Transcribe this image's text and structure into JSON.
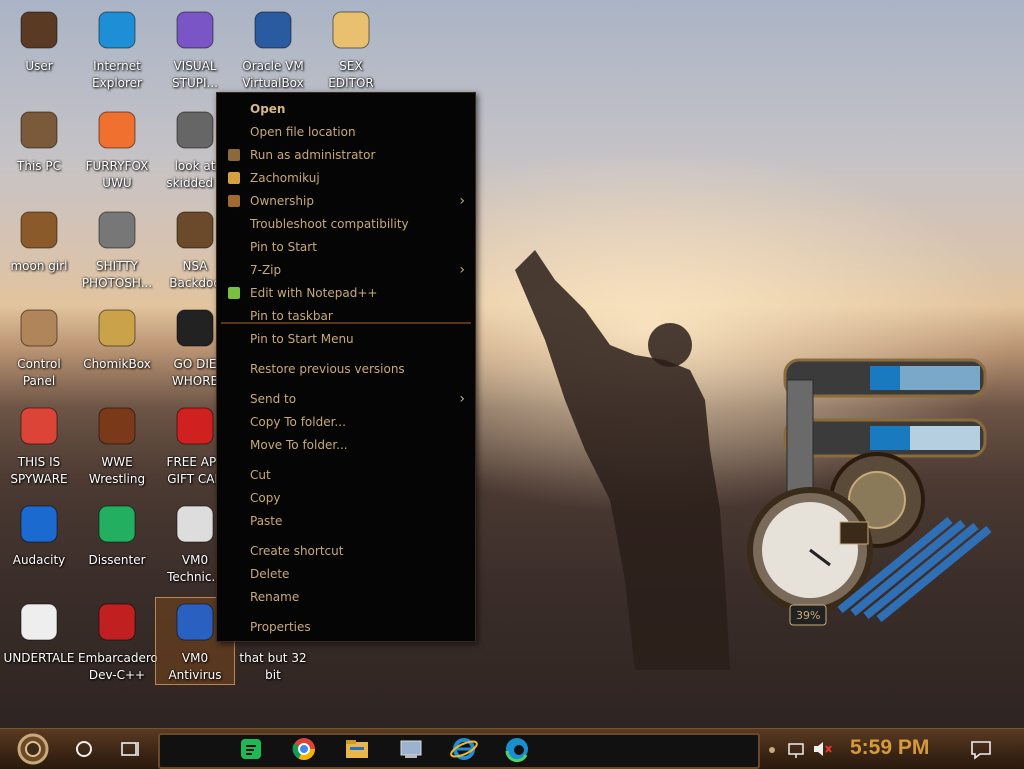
{
  "desktop": {
    "icons": [
      {
        "label1": "User",
        "label2": ""
      },
      {
        "label1": "Internet",
        "label2": "Explorer"
      },
      {
        "label1": "VISUAL",
        "label2": "STUPI..."
      },
      {
        "label1": "Oracle VM",
        "label2": "VirtualBox"
      },
      {
        "label1": "SEX",
        "label2": "EDITOR"
      },
      {
        "label1": "This PC",
        "label2": ""
      },
      {
        "label1": "FURRYFOX",
        "label2": "UWU"
      },
      {
        "label1": "look at",
        "label2": "skidded c"
      },
      {
        "label1": "moon girl",
        "label2": ""
      },
      {
        "label1": "SHITTY",
        "label2": "PHOTOSH..."
      },
      {
        "label1": "NSA",
        "label2": "Backdoo"
      },
      {
        "label1": "Control Panel",
        "label2": ""
      },
      {
        "label1": "ChomikBox",
        "label2": ""
      },
      {
        "label1": "GO DIE",
        "label2": "WHORE"
      },
      {
        "label1": "THIS IS",
        "label2": "SPYWARE"
      },
      {
        "label1": "WWE",
        "label2": "Wrestling"
      },
      {
        "label1": "FREE APP",
        "label2": "GIFT CAR"
      },
      {
        "label1": "Audacity",
        "label2": ""
      },
      {
        "label1": "Dissenter",
        "label2": ""
      },
      {
        "label1": "VM0",
        "label2": "Technic..."
      },
      {
        "label1": "UNDERTALE",
        "label2": ""
      },
      {
        "label1": "Embarcadero",
        "label2": "Dev-C++"
      },
      {
        "label1": "VM0",
        "label2": "Antivirus"
      },
      {
        "label1": "that but 32",
        "label2": "bit"
      }
    ]
  },
  "context_menu": {
    "items": [
      {
        "label": "Open"
      },
      {
        "label": "Open file location"
      },
      {
        "label": "Run as administrator"
      },
      {
        "label": "Zachomikuj"
      },
      {
        "label": "Ownership"
      },
      {
        "label": "Troubleshoot compatibility"
      },
      {
        "label": "Pin to Start"
      },
      {
        "label": "7-Zip"
      },
      {
        "label": "Edit with Notepad++"
      },
      {
        "label": "Pin to taskbar"
      },
      {
        "label": "Pin to Start Menu"
      },
      {
        "label": "Restore previous versions"
      },
      {
        "label": "Send to"
      },
      {
        "label": "Copy To folder..."
      },
      {
        "label": "Move To folder..."
      },
      {
        "label": "Cut"
      },
      {
        "label": "Copy"
      },
      {
        "label": "Paste"
      },
      {
        "label": "Create shortcut"
      },
      {
        "label": "Delete"
      },
      {
        "label": "Rename"
      },
      {
        "label": "Properties"
      }
    ]
  },
  "widget": {
    "percent": "39%"
  },
  "taskbar": {
    "clock": "5:59 PM",
    "pinned": [
      "spotify-icon",
      "chrome-icon",
      "file-explorer-icon",
      "control-panel-icon",
      "internet-explorer-icon",
      "edge-icon"
    ]
  },
  "colors": {
    "menu_text": "#c9a978",
    "clock": "#d49a3c",
    "taskbar": "#3b2514"
  }
}
